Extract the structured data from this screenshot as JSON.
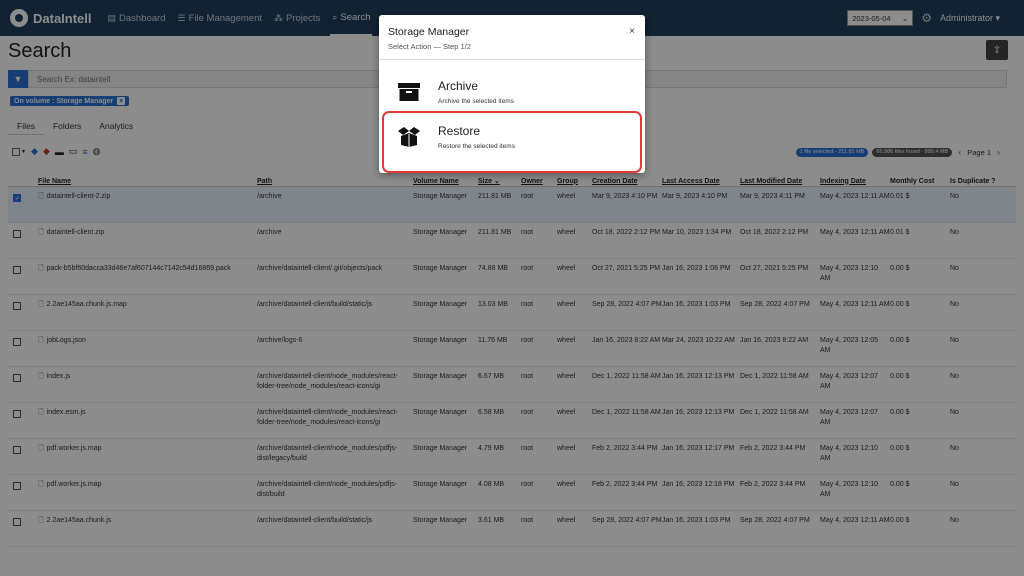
{
  "navbar": {
    "brand": "DataIntell",
    "items": [
      {
        "label": "Dashboard",
        "icon": "dashboard-icon"
      },
      {
        "label": "File Management",
        "icon": "list-icon"
      },
      {
        "label": "Projects",
        "icon": "projects-icon"
      },
      {
        "label": "Search",
        "icon": "search-icon",
        "active": true
      }
    ],
    "date": "2023-05-04",
    "user": "Administrator"
  },
  "page": {
    "title": "Search",
    "search_placeholder": "Search Ex: dataintell",
    "volume_tag": "On volume : Storage Manager",
    "tabs": [
      "Files",
      "Folders",
      "Analytics"
    ],
    "selected_pill": "1 file selected - 211.81 MB",
    "found_pill": "65,986 files found - 899.4 MB",
    "page_label": "Page 1"
  },
  "table": {
    "headers": [
      "File Name",
      "Path",
      "Volume Name",
      "Size ⌄",
      "Owner",
      "Group",
      "Creation Date",
      "Last Access Date",
      "Last Modified Date",
      "Indexing Date",
      "Monthly Cost",
      "Is Duplicate ?"
    ],
    "rows": [
      {
        "checked": true,
        "name": "dataintell-client-2.zip",
        "path": "/archive",
        "volume": "Storage Manager",
        "size": "211.81 MB",
        "owner": "root",
        "group": "wheel",
        "created": "Mar 9, 2023 4:10 PM",
        "accessed": "Mar 9, 2023 4:10 PM",
        "modified": "Mar 9, 2023 4:11 PM",
        "indexed": "May 4, 2023 12:11 AM",
        "cost": "0.01 $",
        "dup": "No"
      },
      {
        "checked": false,
        "name": "dataintell-client.zip",
        "path": "/archive",
        "volume": "Storage Manager",
        "size": "211.81 MB",
        "owner": "root",
        "group": "wheel",
        "created": "Oct 18, 2022 2:12 PM",
        "accessed": "Mar 10, 2023 1:34 PM",
        "modified": "Oct 18, 2022 2:12 PM",
        "indexed": "May 4, 2023 12:11 AM",
        "cost": "0.01 $",
        "dup": "No"
      },
      {
        "checked": false,
        "name": "pack-b5bf60dacca33d46e7af607144c7142c54d16869.pack",
        "path": "/archive/dataintell-client/.git/objects/pack",
        "volume": "Storage Manager",
        "size": "74.88 MB",
        "owner": "root",
        "group": "wheel",
        "created": "Oct 27, 2021 5:25 PM",
        "accessed": "Jan 16, 2023 1:06 PM",
        "modified": "Oct 27, 2021 5:25 PM",
        "indexed": "May 4, 2023 12:10 AM",
        "cost": "0.00 $",
        "dup": "No"
      },
      {
        "checked": false,
        "name": "2.2ae145aa.chunk.js.map",
        "path": "/archive/dataintell-client/build/static/js",
        "volume": "Storage Manager",
        "size": "13.03 MB",
        "owner": "root",
        "group": "wheel",
        "created": "Sep 28, 2022 4:07 PM",
        "accessed": "Jan 16, 2023 1:03 PM",
        "modified": "Sep 28, 2022 4:07 PM",
        "indexed": "May 4, 2023 12:11 AM",
        "cost": "0.00 $",
        "dup": "No"
      },
      {
        "checked": false,
        "name": "jobLogs.json",
        "path": "/archive/logs-6",
        "volume": "Storage Manager",
        "size": "11.76 MB",
        "owner": "root",
        "group": "wheel",
        "created": "Jan 16, 2023 8:22 AM",
        "accessed": "Mar 24, 2023 10:22 AM",
        "modified": "Jan 16, 2023 8:22 AM",
        "indexed": "May 4, 2023 12:05 AM",
        "cost": "0.00 $",
        "dup": "No"
      },
      {
        "checked": false,
        "name": "index.js",
        "path": "/archive/dataintell-client/node_modules/react-folder-tree/node_modules/react-icons/gi",
        "volume": "Storage Manager",
        "size": "6.67 MB",
        "owner": "root",
        "group": "wheel",
        "created": "Dec 1, 2022 11:58 AM",
        "accessed": "Jan 16, 2023 12:13 PM",
        "modified": "Dec 1, 2022 11:58 AM",
        "indexed": "May 4, 2023 12:07 AM",
        "cost": "0.00 $",
        "dup": "No"
      },
      {
        "checked": false,
        "name": "index.esm.js",
        "path": "/archive/dataintell-client/node_modules/react-folder-tree/node_modules/react-icons/gi",
        "volume": "Storage Manager",
        "size": "6.58 MB",
        "owner": "root",
        "group": "wheel",
        "created": "Dec 1, 2022 11:58 AM",
        "accessed": "Jan 16, 2023 12:13 PM",
        "modified": "Dec 1, 2022 11:58 AM",
        "indexed": "May 4, 2023 12:07 AM",
        "cost": "0.00 $",
        "dup": "No"
      },
      {
        "checked": false,
        "name": "pdf.worker.js.map",
        "path": "/archive/dataintell-client/node_modules/pdfjs-dist/legacy/build",
        "volume": "Storage Manager",
        "size": "4.79 MB",
        "owner": "root",
        "group": "wheel",
        "created": "Feb 2, 2022 3:44 PM",
        "accessed": "Jan 16, 2023 12:17 PM",
        "modified": "Feb 2, 2022 3:44 PM",
        "indexed": "May 4, 2023 12:10 AM",
        "cost": "0.00 $",
        "dup": "No"
      },
      {
        "checked": false,
        "name": "pdf.worker.js.map",
        "path": "/archive/dataintell-client/node_modules/pdfjs-dist/build",
        "volume": "Storage Manager",
        "size": "4.08 MB",
        "owner": "root",
        "group": "wheel",
        "created": "Feb 2, 2022 3:44 PM",
        "accessed": "Jan 16, 2023 12:18 PM",
        "modified": "Feb 2, 2022 3:44 PM",
        "indexed": "May 4, 2023 12:10 AM",
        "cost": "0.00 $",
        "dup": "No"
      },
      {
        "checked": false,
        "name": "2.2ae145aa.chunk.js",
        "path": "/archive/dataintell-client/build/static/js",
        "volume": "Storage Manager",
        "size": "3.61 MB",
        "owner": "root",
        "group": "wheel",
        "created": "Sep 28, 2022 4:07 PM",
        "accessed": "Jan 16, 2023 1:03 PM",
        "modified": "Sep 28, 2022 4:07 PM",
        "indexed": "May 4, 2023 12:11 AM",
        "cost": "0.00 $",
        "dup": "No"
      }
    ]
  },
  "modal": {
    "title": "Storage Manager",
    "subtitle": "Select Action — Step 1/2",
    "close": "×",
    "actions": [
      {
        "title": "Archive",
        "desc": "Archive the selected items",
        "icon": "archive-box-icon"
      },
      {
        "title": "Restore",
        "desc": "Restore the selected items",
        "icon": "open-box-icon"
      }
    ]
  },
  "colors": {
    "navbar": "#1f3f5c",
    "accent": "#2a6fd6",
    "highlight": "#e53935"
  }
}
